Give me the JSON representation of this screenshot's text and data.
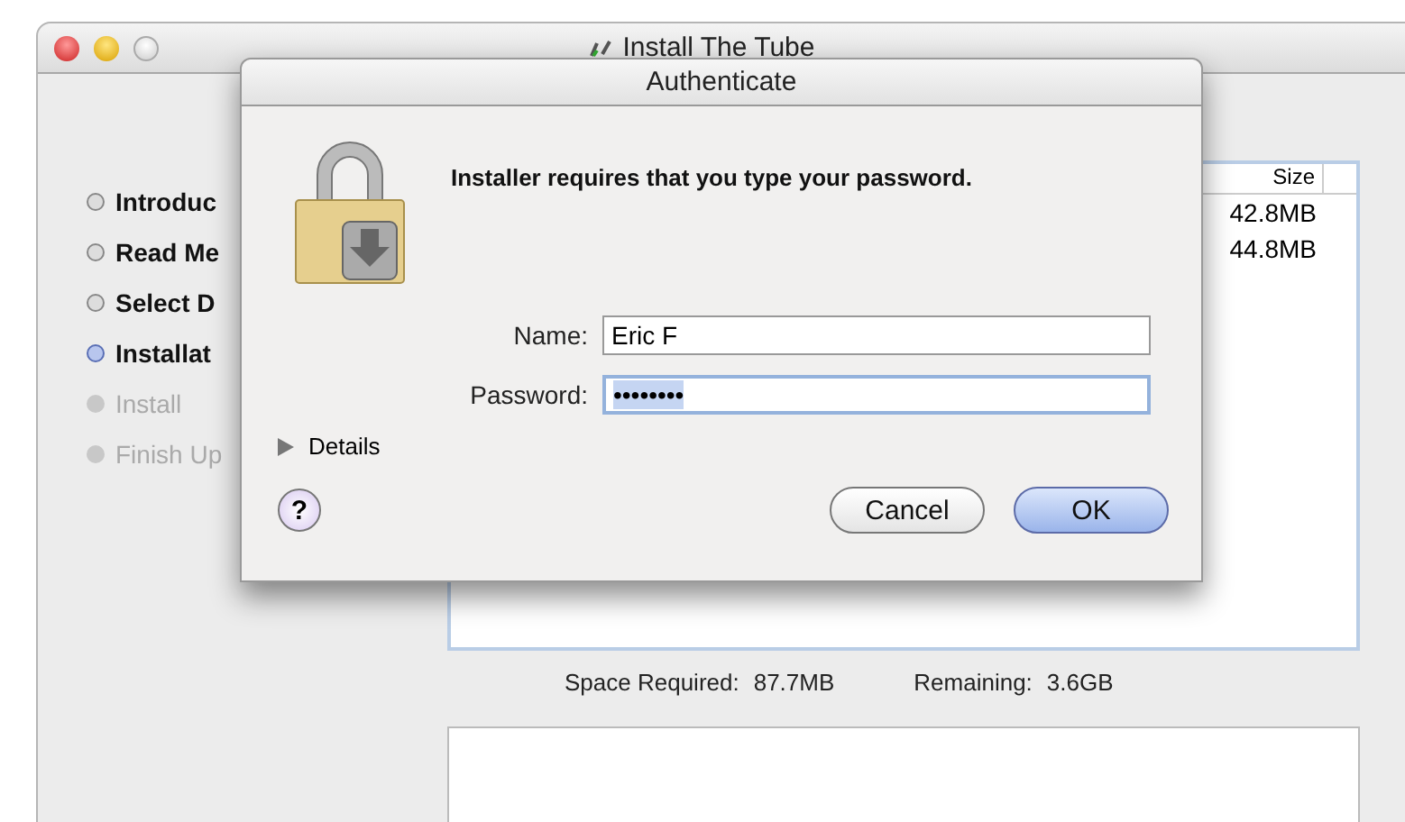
{
  "window": {
    "title": "Install The Tube"
  },
  "steps": [
    {
      "label": "Introduc",
      "selected": false,
      "disabled": false
    },
    {
      "label": "Read Me",
      "selected": false,
      "disabled": false
    },
    {
      "label": "Select D",
      "selected": false,
      "disabled": false
    },
    {
      "label": "Installat",
      "selected": true,
      "disabled": false
    },
    {
      "label": "Install",
      "selected": false,
      "disabled": true
    },
    {
      "label": "Finish Up",
      "selected": false,
      "disabled": true
    }
  ],
  "table": {
    "columns": [
      "Size"
    ],
    "rows": [
      [
        "42.8MB"
      ],
      [
        "44.8MB"
      ]
    ]
  },
  "space": {
    "required_label": "Space Required:",
    "required": "87.7MB",
    "remaining_label": "Remaining:",
    "remaining": "3.6GB"
  },
  "dialog": {
    "title": "Authenticate",
    "message": "Installer requires that you type your password.",
    "fields": [
      {
        "label": "Name:",
        "value": "Eric F",
        "focused": false
      },
      {
        "label": "Password:",
        "value": "••••••••",
        "focused": true
      }
    ],
    "details": "Details",
    "help": "?",
    "buttons": [
      {
        "label": "Cancel",
        "default": false
      },
      {
        "label": "OK",
        "default": true
      }
    ]
  }
}
